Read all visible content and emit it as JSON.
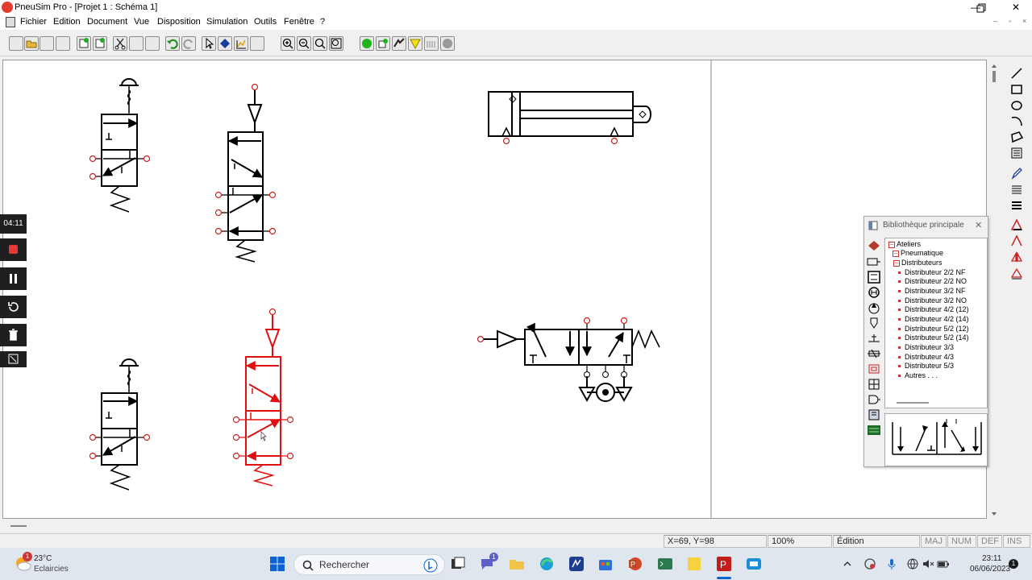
{
  "window": {
    "title": "PneuSim Pro - [Projet 1 : Schéma 1]",
    "min_glyph": "—",
    "max_glyph": "❐",
    "close_glyph": "✕"
  },
  "menu": {
    "items": [
      "Fichier",
      "Edition",
      "Document",
      "Vue",
      "Disposition",
      "Simulation",
      "Outils",
      "Fenêtre",
      "?"
    ],
    "mdi": [
      "–",
      "▫",
      "×"
    ]
  },
  "recorder": {
    "time": "04:11"
  },
  "library": {
    "title": "Bibliothèque principale",
    "close_glyph": "✕",
    "tree": [
      {
        "label": "Ateliers",
        "level": 0,
        "kind": "expander"
      },
      {
        "label": "Pneumatique",
        "level": 1,
        "kind": "expander"
      },
      {
        "label": "Distributeurs",
        "level": 2,
        "kind": "expander"
      },
      {
        "label": "Distributeur 2/2 NF",
        "level": 3,
        "kind": "leaf"
      },
      {
        "label": "Distributeur 2/2 NO",
        "level": 3,
        "kind": "leaf"
      },
      {
        "label": "Distributeur 3/2 NF",
        "level": 3,
        "kind": "leaf"
      },
      {
        "label": "Distributeur 3/2 NO",
        "level": 3,
        "kind": "leaf"
      },
      {
        "label": "Distributeur 4/2 (12)",
        "level": 3,
        "kind": "leaf"
      },
      {
        "label": "Distributeur 4/2 (14)",
        "level": 3,
        "kind": "leaf"
      },
      {
        "label": "Distributeur 5/2 (12)",
        "level": 3,
        "kind": "leaf",
        "selected": true
      },
      {
        "label": "Distributeur 5/2 (14)",
        "level": 3,
        "kind": "leaf"
      },
      {
        "label": "Distributeur 3/3",
        "level": 3,
        "kind": "leaf"
      },
      {
        "label": "Distributeur 4/3",
        "level": 3,
        "kind": "leaf"
      },
      {
        "label": "Distributeur 5/3",
        "level": 3,
        "kind": "leaf"
      },
      {
        "label": "Autres . . .",
        "level": 3,
        "kind": "leaf"
      }
    ]
  },
  "status": {
    "coords": "X=69, Y=98",
    "zoom": "100%",
    "mode": "Édition",
    "maj": "MAJ",
    "num": "NUM",
    "def": "DEF",
    "ins": "INS"
  },
  "taskbar": {
    "weather_temp": "23°C",
    "weather_desc": "Eclaircies",
    "weather_badge": "1",
    "search_placeholder": "Rechercher",
    "chat_badge": "1",
    "time": "23:11",
    "date": "06/06/2023",
    "notif_badge": "1"
  },
  "colors": {
    "accent": "#0a64d8",
    "selected_component": "#e01010",
    "port": "#cc2222",
    "recorder_bg": "#1f1f1f",
    "recorder_stop": "#e53935"
  }
}
